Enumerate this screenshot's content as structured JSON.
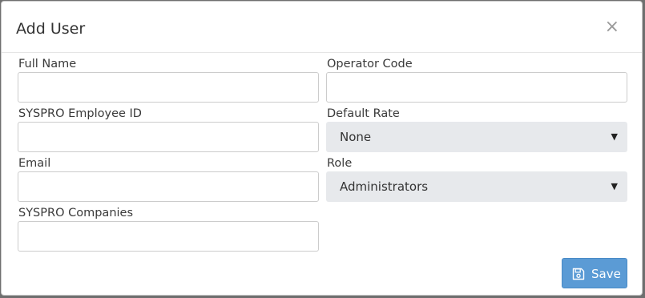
{
  "dialog": {
    "title": "Add User",
    "close_symbol": "×"
  },
  "form": {
    "full_name": {
      "label": "Full Name",
      "value": ""
    },
    "operator_code": {
      "label": "Operator Code",
      "value": ""
    },
    "syspro_employee_id": {
      "label": "SYSPRO Employee ID",
      "value": ""
    },
    "default_rate": {
      "label": "Default Rate",
      "value": "None"
    },
    "email": {
      "label": "Email",
      "value": ""
    },
    "role": {
      "label": "Role",
      "value": "Administrators"
    },
    "syspro_companies": {
      "label": "SYSPRO Companies",
      "value": ""
    }
  },
  "footer": {
    "save_label": "Save",
    "save_icon": "floppy-disk-icon"
  },
  "colors": {
    "save_button": "#5b9bd5",
    "select_background": "#e7e9ec"
  }
}
